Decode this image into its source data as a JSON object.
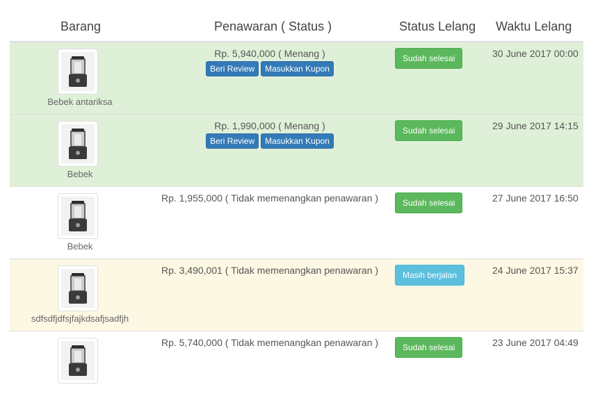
{
  "headers": {
    "item": "Barang",
    "offer": "Penawaran ( Status )",
    "auction_status": "Status Lelang",
    "auction_time": "Waktu Lelang"
  },
  "rows": [
    {
      "name": "Bebek antariksa",
      "offer": "Rp. 5,940,000 ( Menang )",
      "review_label": "Beri Review",
      "coupon_label": "Masukkan Kupon",
      "status": "Sudah selesai",
      "time": "30 June 2017 00:00"
    },
    {
      "name": "Bebek",
      "offer": "Rp. 1,990,000 ( Menang )",
      "review_label": "Beri Review",
      "coupon_label": "Masukkan Kupon",
      "status": "Sudah selesai",
      "time": "29 June 2017 14:15"
    },
    {
      "name": "Bebek",
      "offer": "Rp. 1,955,000 ( Tidak memenangkan penawaran )",
      "status": "Sudah selesai",
      "time": "27 June 2017 16:50"
    },
    {
      "name": "sdfsdfjdfsjfajkdsafjsadfjh",
      "offer": "Rp. 3,490,001 ( Tidak memenangkan penawaran )",
      "status": "Masih berjalan",
      "time": "24 June 2017 15:37"
    },
    {
      "name": "",
      "offer": "Rp. 5,740,000 ( Tidak memenangkan penawaran )",
      "status": "Sudah selesai",
      "time": "23 June 2017 04:49"
    }
  ],
  "colors": {
    "success_row": "#dff0d8",
    "warning_row": "#fcf8e3",
    "label_success": "#5cb85c",
    "label_info": "#5bc0de",
    "button_primary": "#337ab7"
  },
  "icons": {
    "product_image": "food-processor-icon"
  }
}
